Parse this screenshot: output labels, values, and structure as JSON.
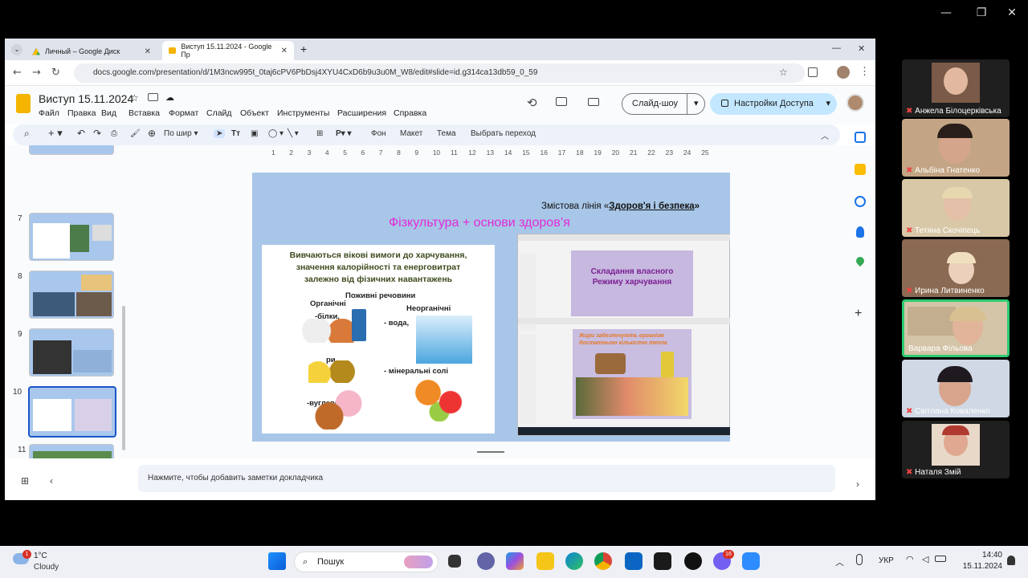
{
  "window": {
    "minimize": "—",
    "maximize": "❐",
    "close": "✕"
  },
  "tabs": [
    {
      "label": "Личный – Google Диск"
    },
    {
      "label": "Виступ 15.11.2024 - Google Пр"
    }
  ],
  "tab_new": "+",
  "address": {
    "url": "docs.google.com/presentation/d/1M3ncw995t_0taj6cPV6PbDsj4XYU4CxD6b9u3u0M_W8/edit#slide=id.g314ca13db59_0_59"
  },
  "doc": {
    "title": "Виступ 15.11.2024",
    "menu": [
      "Файл",
      "Правка",
      "Вид",
      "Вставка",
      "Формат",
      "Слайд",
      "Объект",
      "Инструменты",
      "Расширения",
      "Справка"
    ],
    "slideshow": "Слайд-шоу",
    "share": "Настройки Доступа"
  },
  "toolbar": {
    "zoom": "По шир",
    "bg": "Фон",
    "layout": "Макет",
    "theme": "Тема",
    "transition": "Выбрать переход"
  },
  "ruler": [
    "1",
    "2",
    "3",
    "4",
    "5",
    "6",
    "7",
    "8",
    "9",
    "10",
    "11",
    "12",
    "13",
    "14",
    "15",
    "16",
    "17",
    "18",
    "19",
    "20",
    "21",
    "22",
    "23",
    "24",
    "25"
  ],
  "slides": [
    {
      "n": "7"
    },
    {
      "n": "8"
    },
    {
      "n": "9"
    },
    {
      "n": "10"
    },
    {
      "n": "11"
    }
  ],
  "slide": {
    "line_label": "Змістова  лінія «",
    "line_bold": "Здоров'я і безпека",
    "line_end": "»",
    "title": "Фізкультура + основи здоров’я",
    "box_text": [
      "Вивчаються вікові вимоги до харчування,",
      "значення калорійності та енерговитрат",
      "залежно від фізичних навантажень"
    ],
    "nutrients": "Поживні речовини",
    "organic": "Органічні",
    "inorganic": "Неорганічні",
    "proteins": "-білки,",
    "water": "- вода,",
    "fats": "ри,",
    "minerals": "- мінеральні солі",
    "carbs": "-вуглеводи",
    "shot1_title": [
      "Складання власного",
      "Режиму харчування"
    ],
    "shot2_title": [
      "Жири забезпечують організм",
      "достатньою кількістю тепла"
    ]
  },
  "notes": "Нажмите, чтобы добавить заметки докладчика",
  "participants": [
    {
      "name": "Анжела Білоцерківська"
    },
    {
      "name": "Альбіна Гнатенко"
    },
    {
      "name": "Тетяна Скочіпець"
    },
    {
      "name": "Ирина Литвиненко"
    },
    {
      "name": "Варвара Фільова"
    },
    {
      "name": "Світлана Коваленко"
    },
    {
      "name": "Наталя Змій"
    }
  ],
  "taskbar": {
    "temp": "1°C",
    "weather": "Cloudy",
    "weather_badge": "1",
    "search": "Пошук",
    "lang": "УКР",
    "time": "14:40",
    "date": "15.11.2024",
    "viber_badge": "16"
  }
}
